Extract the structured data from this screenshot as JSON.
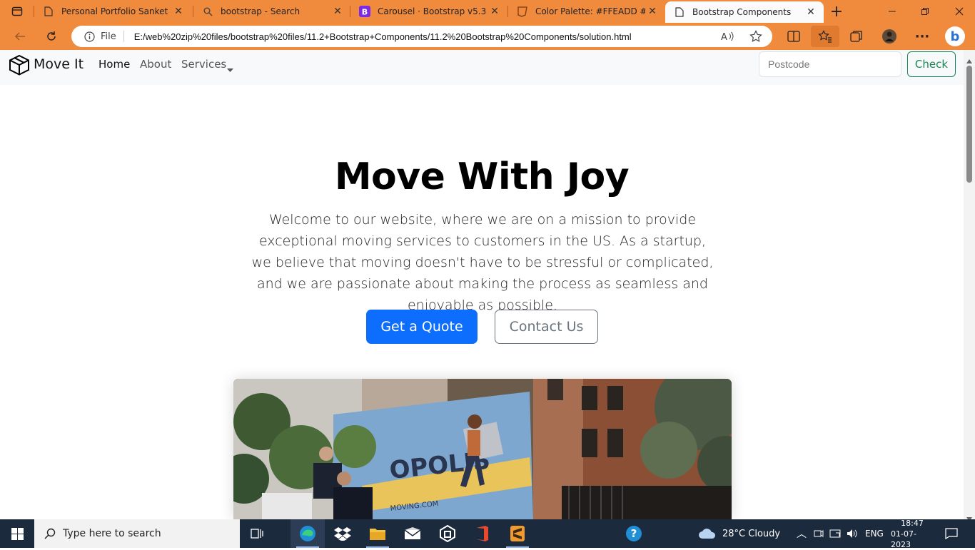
{
  "browser": {
    "tabs": [
      {
        "title": "Personal Portfolio Sanket",
        "icon": "page-icon"
      },
      {
        "title": "bootstrap - Search",
        "icon": "search-icon"
      },
      {
        "title": "Carousel · Bootstrap v5.3",
        "icon": "bootstrap-icon"
      },
      {
        "title": "Color Palette: #FFEADD #FCA",
        "icon": "palette-icon"
      },
      {
        "title": "Bootstrap Components",
        "icon": "page-icon"
      }
    ],
    "file_label": "File",
    "url": "E:/web%20zip%20files/bootstrap%20files/11.2+Bootstrap+Components/11.2%20Bootstrap%20Components/solution.html"
  },
  "navbar": {
    "brand": "Move It",
    "links": [
      "Home",
      "About",
      "Services"
    ],
    "postcode_placeholder": "Postcode",
    "check_label": "Check"
  },
  "hero": {
    "title": "Move With Joy",
    "text": "Welcome to our website, where we are on a mission to provide exceptional moving services to customers in the US. As a startup, we believe that moving doesn't have to be stressful or complicated, and we are passionate about making the process as seamless and enjoyable as possible.",
    "quote_button": "Get a Quote",
    "contact_button": "Contact Us"
  },
  "taskbar": {
    "search_placeholder": "Type here to search",
    "weather": "28°C  Cloudy",
    "language": "ENG",
    "time": "18:47",
    "date": "01-07-2023"
  },
  "colors": {
    "browser_frame": "#f08a3c",
    "primary": "#0d6efd",
    "success": "#198754",
    "secondary": "#6c757d",
    "taskbar": "#1c2a3e"
  }
}
